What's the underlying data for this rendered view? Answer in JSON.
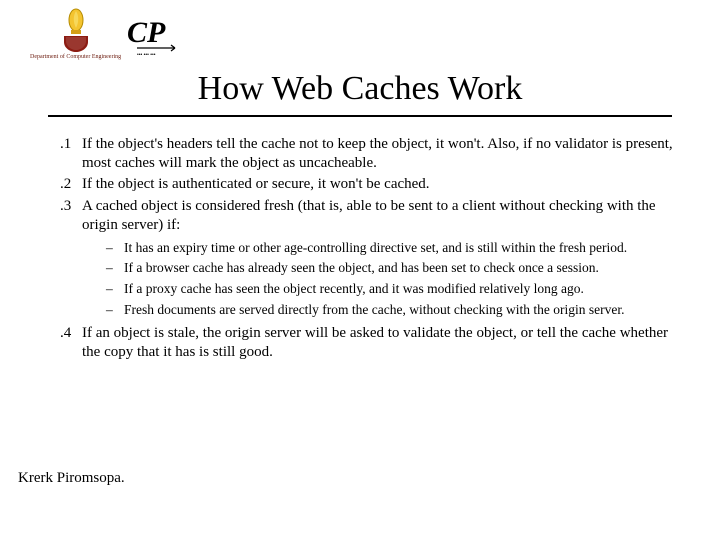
{
  "logos": {
    "dept_caption": "Department of Computer Engineering"
  },
  "title": "How Web Caches Work",
  "items": {
    "n1": ".1",
    "t1": "If the object's headers tell the cache not to keep the object, it won't. Also, if no validator is present, most caches will mark the object as uncacheable.",
    "n2": ".2",
    "t2": "If the object is authenticated or secure, it won't be cached.",
    "n3": ".3",
    "t3": "A cached object is considered fresh (that is, able to be sent to a client without checking with the origin server) if:",
    "s1": "It has an expiry time or other age-controlling directive set, and is still within the fresh period.",
    "s2": "If a browser cache has already seen the object, and has been set to check once a session.",
    "s3": "If a proxy cache has seen the object recently, and it was modified relatively long ago.",
    "s4": "Fresh documents are served directly from the cache, without checking with the origin server.",
    "n4": ".4",
    "t4": "If an object is stale, the origin server will be asked to validate the object, or tell the cache whether the copy that it has is still good."
  },
  "author": "Krerk Piromsopa.",
  "dash": "–"
}
